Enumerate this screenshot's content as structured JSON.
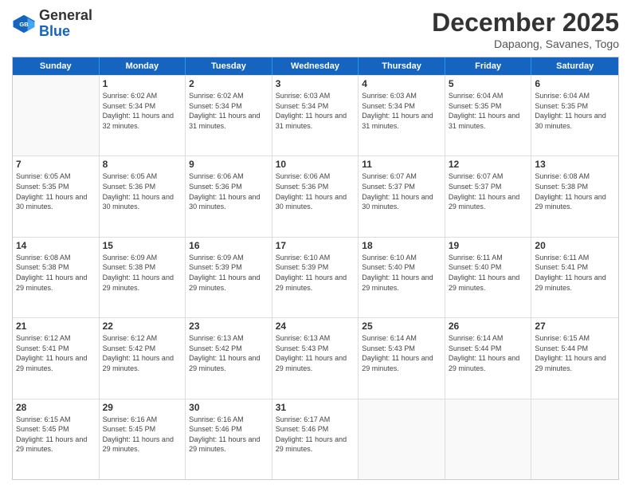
{
  "header": {
    "logo_general": "General",
    "logo_blue": "Blue",
    "month_title": "December 2025",
    "subtitle": "Dapaong, Savanes, Togo"
  },
  "days_of_week": [
    "Sunday",
    "Monday",
    "Tuesday",
    "Wednesday",
    "Thursday",
    "Friday",
    "Saturday"
  ],
  "weeks": [
    [
      {
        "day": "",
        "sunrise": "",
        "sunset": "",
        "daylight": ""
      },
      {
        "day": "1",
        "sunrise": "Sunrise: 6:02 AM",
        "sunset": "Sunset: 5:34 PM",
        "daylight": "Daylight: 11 hours and 32 minutes."
      },
      {
        "day": "2",
        "sunrise": "Sunrise: 6:02 AM",
        "sunset": "Sunset: 5:34 PM",
        "daylight": "Daylight: 11 hours and 31 minutes."
      },
      {
        "day": "3",
        "sunrise": "Sunrise: 6:03 AM",
        "sunset": "Sunset: 5:34 PM",
        "daylight": "Daylight: 11 hours and 31 minutes."
      },
      {
        "day": "4",
        "sunrise": "Sunrise: 6:03 AM",
        "sunset": "Sunset: 5:34 PM",
        "daylight": "Daylight: 11 hours and 31 minutes."
      },
      {
        "day": "5",
        "sunrise": "Sunrise: 6:04 AM",
        "sunset": "Sunset: 5:35 PM",
        "daylight": "Daylight: 11 hours and 31 minutes."
      },
      {
        "day": "6",
        "sunrise": "Sunrise: 6:04 AM",
        "sunset": "Sunset: 5:35 PM",
        "daylight": "Daylight: 11 hours and 30 minutes."
      }
    ],
    [
      {
        "day": "7",
        "sunrise": "Sunrise: 6:05 AM",
        "sunset": "Sunset: 5:35 PM",
        "daylight": "Daylight: 11 hours and 30 minutes."
      },
      {
        "day": "8",
        "sunrise": "Sunrise: 6:05 AM",
        "sunset": "Sunset: 5:36 PM",
        "daylight": "Daylight: 11 hours and 30 minutes."
      },
      {
        "day": "9",
        "sunrise": "Sunrise: 6:06 AM",
        "sunset": "Sunset: 5:36 PM",
        "daylight": "Daylight: 11 hours and 30 minutes."
      },
      {
        "day": "10",
        "sunrise": "Sunrise: 6:06 AM",
        "sunset": "Sunset: 5:36 PM",
        "daylight": "Daylight: 11 hours and 30 minutes."
      },
      {
        "day": "11",
        "sunrise": "Sunrise: 6:07 AM",
        "sunset": "Sunset: 5:37 PM",
        "daylight": "Daylight: 11 hours and 30 minutes."
      },
      {
        "day": "12",
        "sunrise": "Sunrise: 6:07 AM",
        "sunset": "Sunset: 5:37 PM",
        "daylight": "Daylight: 11 hours and 29 minutes."
      },
      {
        "day": "13",
        "sunrise": "Sunrise: 6:08 AM",
        "sunset": "Sunset: 5:38 PM",
        "daylight": "Daylight: 11 hours and 29 minutes."
      }
    ],
    [
      {
        "day": "14",
        "sunrise": "Sunrise: 6:08 AM",
        "sunset": "Sunset: 5:38 PM",
        "daylight": "Daylight: 11 hours and 29 minutes."
      },
      {
        "day": "15",
        "sunrise": "Sunrise: 6:09 AM",
        "sunset": "Sunset: 5:38 PM",
        "daylight": "Daylight: 11 hours and 29 minutes."
      },
      {
        "day": "16",
        "sunrise": "Sunrise: 6:09 AM",
        "sunset": "Sunset: 5:39 PM",
        "daylight": "Daylight: 11 hours and 29 minutes."
      },
      {
        "day": "17",
        "sunrise": "Sunrise: 6:10 AM",
        "sunset": "Sunset: 5:39 PM",
        "daylight": "Daylight: 11 hours and 29 minutes."
      },
      {
        "day": "18",
        "sunrise": "Sunrise: 6:10 AM",
        "sunset": "Sunset: 5:40 PM",
        "daylight": "Daylight: 11 hours and 29 minutes."
      },
      {
        "day": "19",
        "sunrise": "Sunrise: 6:11 AM",
        "sunset": "Sunset: 5:40 PM",
        "daylight": "Daylight: 11 hours and 29 minutes."
      },
      {
        "day": "20",
        "sunrise": "Sunrise: 6:11 AM",
        "sunset": "Sunset: 5:41 PM",
        "daylight": "Daylight: 11 hours and 29 minutes."
      }
    ],
    [
      {
        "day": "21",
        "sunrise": "Sunrise: 6:12 AM",
        "sunset": "Sunset: 5:41 PM",
        "daylight": "Daylight: 11 hours and 29 minutes."
      },
      {
        "day": "22",
        "sunrise": "Sunrise: 6:12 AM",
        "sunset": "Sunset: 5:42 PM",
        "daylight": "Daylight: 11 hours and 29 minutes."
      },
      {
        "day": "23",
        "sunrise": "Sunrise: 6:13 AM",
        "sunset": "Sunset: 5:42 PM",
        "daylight": "Daylight: 11 hours and 29 minutes."
      },
      {
        "day": "24",
        "sunrise": "Sunrise: 6:13 AM",
        "sunset": "Sunset: 5:43 PM",
        "daylight": "Daylight: 11 hours and 29 minutes."
      },
      {
        "day": "25",
        "sunrise": "Sunrise: 6:14 AM",
        "sunset": "Sunset: 5:43 PM",
        "daylight": "Daylight: 11 hours and 29 minutes."
      },
      {
        "day": "26",
        "sunrise": "Sunrise: 6:14 AM",
        "sunset": "Sunset: 5:44 PM",
        "daylight": "Daylight: 11 hours and 29 minutes."
      },
      {
        "day": "27",
        "sunrise": "Sunrise: 6:15 AM",
        "sunset": "Sunset: 5:44 PM",
        "daylight": "Daylight: 11 hours and 29 minutes."
      }
    ],
    [
      {
        "day": "28",
        "sunrise": "Sunrise: 6:15 AM",
        "sunset": "Sunset: 5:45 PM",
        "daylight": "Daylight: 11 hours and 29 minutes."
      },
      {
        "day": "29",
        "sunrise": "Sunrise: 6:16 AM",
        "sunset": "Sunset: 5:45 PM",
        "daylight": "Daylight: 11 hours and 29 minutes."
      },
      {
        "day": "30",
        "sunrise": "Sunrise: 6:16 AM",
        "sunset": "Sunset: 5:46 PM",
        "daylight": "Daylight: 11 hours and 29 minutes."
      },
      {
        "day": "31",
        "sunrise": "Sunrise: 6:17 AM",
        "sunset": "Sunset: 5:46 PM",
        "daylight": "Daylight: 11 hours and 29 minutes."
      },
      {
        "day": "",
        "sunrise": "",
        "sunset": "",
        "daylight": ""
      },
      {
        "day": "",
        "sunrise": "",
        "sunset": "",
        "daylight": ""
      },
      {
        "day": "",
        "sunrise": "",
        "sunset": "",
        "daylight": ""
      }
    ]
  ]
}
